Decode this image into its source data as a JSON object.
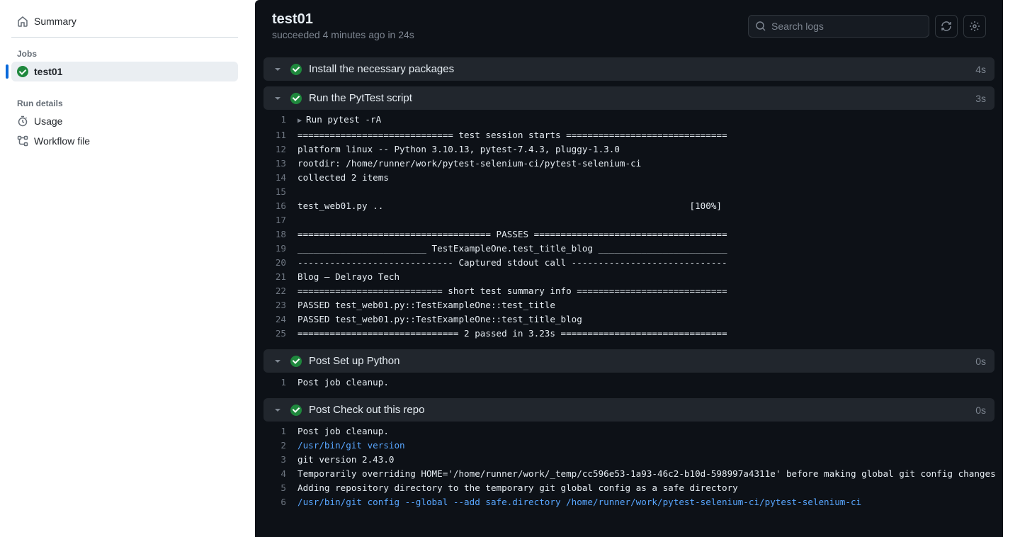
{
  "sidebar": {
    "summary_label": "Summary",
    "jobs_heading": "Jobs",
    "job_name": "test01",
    "run_details_heading": "Run details",
    "usage_label": "Usage",
    "workflow_file_label": "Workflow file"
  },
  "header": {
    "title": "test01",
    "subtitle": "succeeded 4 minutes ago in 24s",
    "search_placeholder": "Search logs"
  },
  "steps": [
    {
      "title": "Install the necessary packages",
      "duration": "4s",
      "expanded": false,
      "lines": []
    },
    {
      "title": "Run the PytTest script",
      "duration": "3s",
      "expanded": true,
      "lines": [
        {
          "no": "1",
          "text": "Run pytest -rA",
          "expandable": true
        },
        {
          "no": "11",
          "text": "============================= test session starts =============================="
        },
        {
          "no": "12",
          "text": "platform linux -- Python 3.10.13, pytest-7.4.3, pluggy-1.3.0"
        },
        {
          "no": "13",
          "text": "rootdir: /home/runner/work/pytest-selenium-ci/pytest-selenium-ci"
        },
        {
          "no": "14",
          "text": "collected 2 items"
        },
        {
          "no": "15",
          "text": ""
        },
        {
          "no": "16",
          "text": "test_web01.py ..                                                         [100%]"
        },
        {
          "no": "17",
          "text": ""
        },
        {
          "no": "18",
          "text": "==================================== PASSES ===================================="
        },
        {
          "no": "19",
          "text": "________________________ TestExampleOne.test_title_blog ________________________"
        },
        {
          "no": "20",
          "text": "----------------------------- Captured stdout call -----------------------------"
        },
        {
          "no": "21",
          "text": "Blog – Delrayo Tech"
        },
        {
          "no": "22",
          "text": "=========================== short test summary info ============================"
        },
        {
          "no": "23",
          "text": "PASSED test_web01.py::TestExampleOne::test_title"
        },
        {
          "no": "24",
          "text": "PASSED test_web01.py::TestExampleOne::test_title_blog"
        },
        {
          "no": "25",
          "text": "============================== 2 passed in 3.23s ==============================="
        }
      ]
    },
    {
      "title": "Post Set up Python",
      "duration": "0s",
      "expanded": true,
      "lines": [
        {
          "no": "1",
          "text": "Post job cleanup."
        }
      ]
    },
    {
      "title": "Post Check out this repo",
      "duration": "0s",
      "expanded": true,
      "lines": [
        {
          "no": "1",
          "text": "Post job cleanup."
        },
        {
          "no": "2",
          "text": "/usr/bin/git version",
          "color": "blue"
        },
        {
          "no": "3",
          "text": "git version 2.43.0"
        },
        {
          "no": "4",
          "text": "Temporarily overriding HOME='/home/runner/work/_temp/cc596e53-1a93-46c2-b10d-598997a4311e' before making global git config changes"
        },
        {
          "no": "5",
          "text": "Adding repository directory to the temporary git global config as a safe directory"
        },
        {
          "no": "6",
          "text": "/usr/bin/git config --global --add safe.directory /home/runner/work/pytest-selenium-ci/pytest-selenium-ci",
          "color": "blue"
        }
      ]
    }
  ]
}
